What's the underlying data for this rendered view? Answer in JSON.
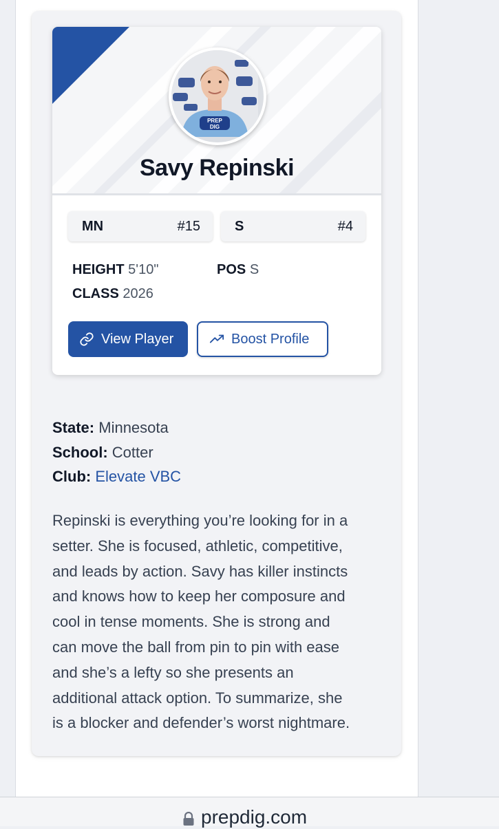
{
  "player": {
    "name": "Savy Repinski",
    "chip_left_label": "MN",
    "chip_left_value": "#15",
    "chip_right_label": "S",
    "chip_right_value": "#4",
    "height_label": "HEIGHT",
    "height_value": "5'10\"",
    "class_label": "CLASS",
    "class_value": "2026",
    "pos_label": "POS",
    "pos_value": "S",
    "photo_shirt_text_1": "PREP",
    "photo_shirt_text_2": "DIG"
  },
  "buttons": {
    "view_player": "View Player",
    "boost_profile": "Boost Profile",
    "view_player_icon": "link-icon",
    "boost_profile_icon": "trending-up-icon"
  },
  "details": {
    "state_label": "State:",
    "state_value": "Minnesota",
    "school_label": "School:",
    "school_value": "Cotter",
    "club_label": "Club:",
    "club_value": "Elevate VBC"
  },
  "bio": {
    "lines": [
      "Repinski is everything you’re looking for in a",
      "setter. She is focused, athletic, competitive,",
      "and leads by action. Savy has killer instincts",
      "and knows how to keep her composure and",
      "cool in tense moments. She is strong and",
      "can move the ball from pin to pin with ease",
      "and she’s a lefty so she presents an",
      "additional attack option. To summarize, she",
      "is a blocker and defender’s worst nightmare."
    ]
  },
  "browser": {
    "url": "prepdig.com",
    "lock_icon": "lock-icon"
  },
  "colors": {
    "brand_blue": "#2453a4",
    "page_bg": "#eef0f4",
    "card_bg": "#f2f3f6"
  }
}
